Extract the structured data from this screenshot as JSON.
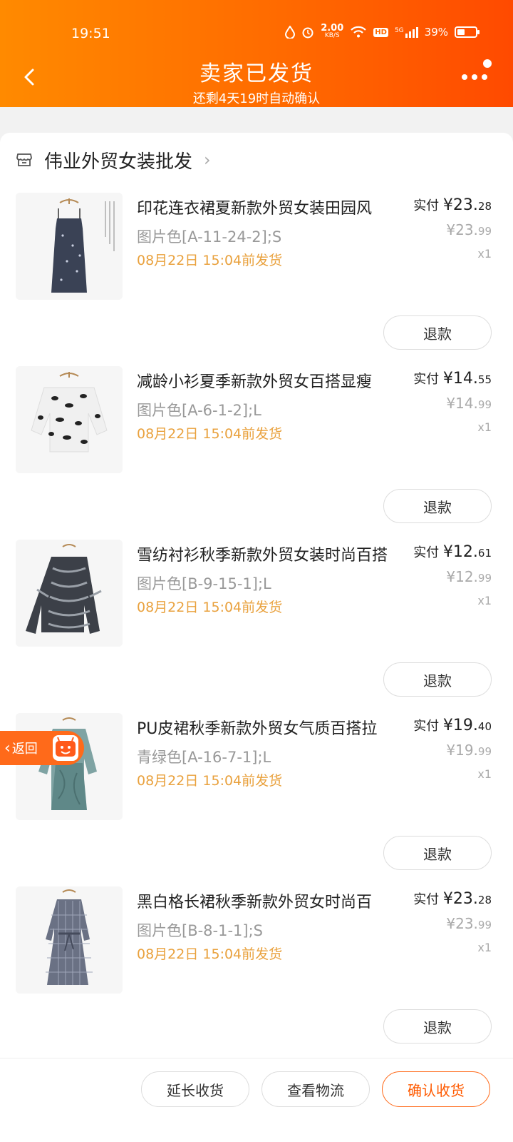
{
  "status_bar": {
    "time": "19:51",
    "net_speed": "2.00",
    "net_unit": "KB/S",
    "hd": "HD",
    "signal": "5G",
    "battery": "39%"
  },
  "header": {
    "title": "卖家已发货",
    "subtitle": "还剩4天19时自动确认"
  },
  "shop": {
    "name": "伟业外贸女装批发"
  },
  "items": [
    {
      "title": "印花连衣裙夏新款外贸女装田园风",
      "spec": "图片色[A-11-24-2];S",
      "ship": "08月22日 15:04前发货",
      "paid_label": "实付",
      "paid_int": "¥23.",
      "paid_dec": "28",
      "orig_int": "¥23.",
      "orig_dec": "99",
      "qty": "x1",
      "refund": "退款"
    },
    {
      "title": "减龄小衫夏季新款外贸女百搭显瘦",
      "spec": "图片色[A-6-1-2];L",
      "ship": "08月22日 15:04前发货",
      "paid_label": "实付",
      "paid_int": "¥14.",
      "paid_dec": "55",
      "orig_int": "¥14.",
      "orig_dec": "99",
      "qty": "x1",
      "refund": "退款"
    },
    {
      "title": "雪纺衬衫秋季新款外贸女装时尚百搭",
      "spec": "图片色[B-9-15-1];L",
      "ship": "08月22日 15:04前发货",
      "paid_label": "实付",
      "paid_int": "¥12.",
      "paid_dec": "61",
      "orig_int": "¥12.",
      "orig_dec": "99",
      "qty": "x1",
      "refund": "退款"
    },
    {
      "title": "PU皮裙秋季新款外贸女气质百搭拉",
      "spec": "青绿色[A-16-7-1];L",
      "ship": "08月22日 15:04前发货",
      "paid_label": "实付",
      "paid_int": "¥19.",
      "paid_dec": "40",
      "orig_int": "¥19.",
      "orig_dec": "99",
      "qty": "x1",
      "refund": "退款"
    },
    {
      "title": "黑白格长裙秋季新款外贸女时尚百",
      "spec": "图片色[B-8-1-1];S",
      "ship": "08月22日 15:04前发货",
      "paid_label": "实付",
      "paid_int": "¥23.",
      "paid_dec": "28",
      "orig_int": "¥23.",
      "orig_dec": "99",
      "qty": "x1",
      "refund": "退款"
    }
  ],
  "float_back": {
    "label": "返回"
  },
  "bottom": {
    "extend": "延长收货",
    "logistics": "查看物流",
    "confirm": "确认收货"
  },
  "colors": {
    "accent": "#ff6a00",
    "ship_text": "#e9a13d"
  }
}
